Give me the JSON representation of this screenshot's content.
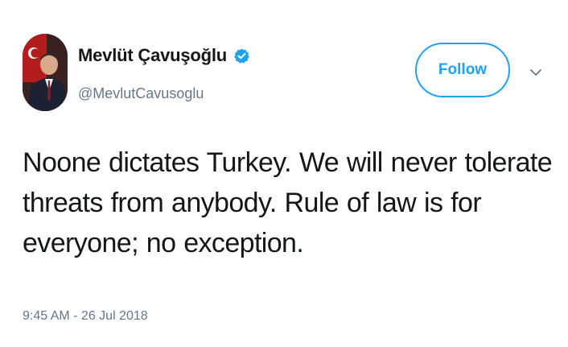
{
  "tweet": {
    "author": {
      "display_name": "Mevlüt Çavuşoğlu",
      "handle": "@MevlutCavusoglu",
      "verified": true,
      "avatar_icon": "profile-photo"
    },
    "follow_label": "Follow",
    "menu_icon": "chevron-down-icon",
    "text_lines": [
      "Noone dictates Turkey. We will never tolerate",
      "threats from anybody. Rule of law is for",
      "everyone; no exception."
    ],
    "timestamp": "9:45 AM - 26 Jul 2018"
  },
  "colors": {
    "accent": "#1da1f2",
    "text": "#14171a",
    "secondary": "#657786"
  }
}
